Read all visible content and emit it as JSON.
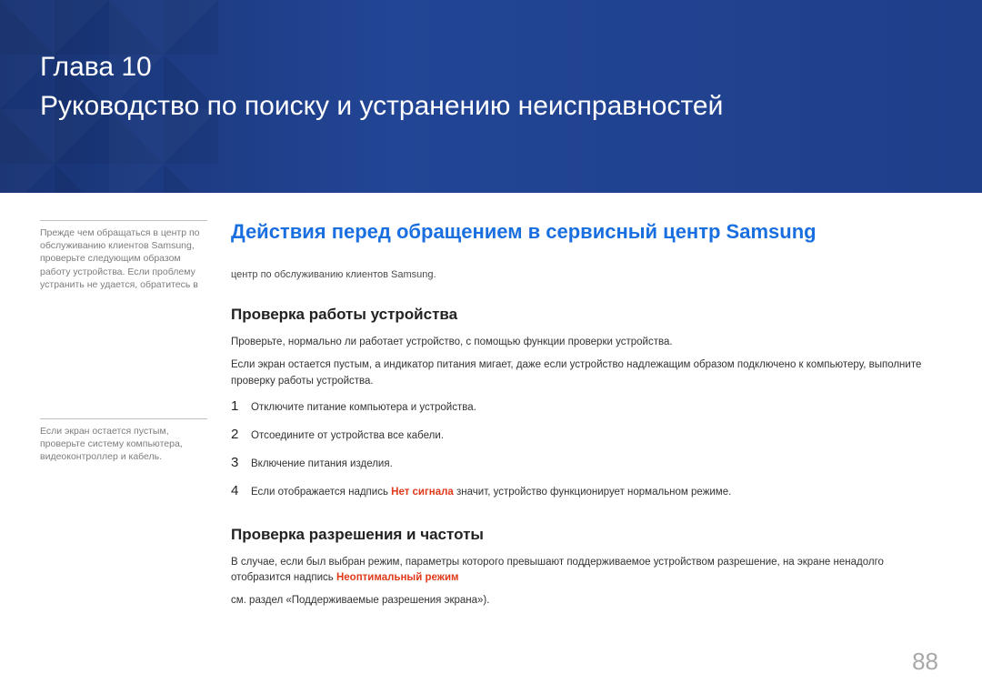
{
  "header": {
    "chapter_label": "Глава 10",
    "title": "Руководство по поиску и устранению неисправностей"
  },
  "sidebar": {
    "note1": "Прежде чем обращаться в центр по обслуживанию клиентов Samsung, проверьте следующим образом работу устройства. Если проблему устранить не удается, обратитесь в",
    "note2": "Если экран остается пустым, проверьте систему компьютера, видеоконтроллер и кабель."
  },
  "main": {
    "h1": "Действия перед обращением в сервисный центр Samsung",
    "intro": "центр по обслуживанию клиентов Samsung.",
    "section1": {
      "title": "Проверка работы устройства",
      "p1": "Проверьте, нормально ли работает устройство, с помощью функции проверки устройства.",
      "p2": "Если экран остается пустым, а индикатор питания мигает, даже если устройство надлежащим образом подключено к компьютеру, выполните проверку работы устройства.",
      "steps": [
        "Отключите питание компьютера и устройства.",
        "Отсоедините от устройства все кабели.",
        "Включение питания изделия."
      ],
      "step4_prefix": "Если отображается надпись ",
      "step4_highlight": "Нет сигнала",
      "step4_suffix": " значит, устройство функционирует нормальном режиме."
    },
    "section2": {
      "title": "Проверка разрешения и частоты",
      "p1_prefix": "В случае, если был выбран режим, параметры которого превышают поддерживаемое устройством разрешение, на экране ненадолго отобразится надпись ",
      "p1_highlight": "Неоптимальный режим",
      "p2": "см. раздел «Поддерживаемые разрешения экрана»)."
    }
  },
  "page_number": "88"
}
